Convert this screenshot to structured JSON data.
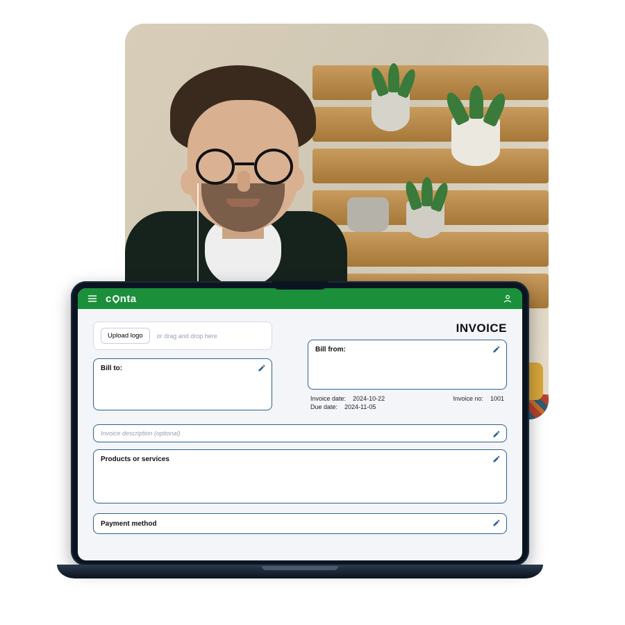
{
  "brand": "conta",
  "header": {
    "menu_icon": "menu-icon",
    "user_icon": "user-icon"
  },
  "invoice": {
    "title": "INVOICE",
    "upload_button": "Upload logo",
    "upload_hint": "or drag and drop here",
    "bill_to_label": "Bill to:",
    "bill_from_label": "Bill from:",
    "invoice_date_label": "Invoice date:",
    "invoice_date_value": "2024-10-22",
    "due_date_label": "Due date:",
    "due_date_value": "2024-11-05",
    "invoice_no_label": "Invoice no:",
    "invoice_no_value": "1001",
    "description_placeholder": "Invoice description (optional)",
    "products_label": "Products or services",
    "payment_label": "Payment method"
  },
  "colors": {
    "brand_green": "#1b8f3a",
    "panel_border": "#2f5f8e"
  }
}
